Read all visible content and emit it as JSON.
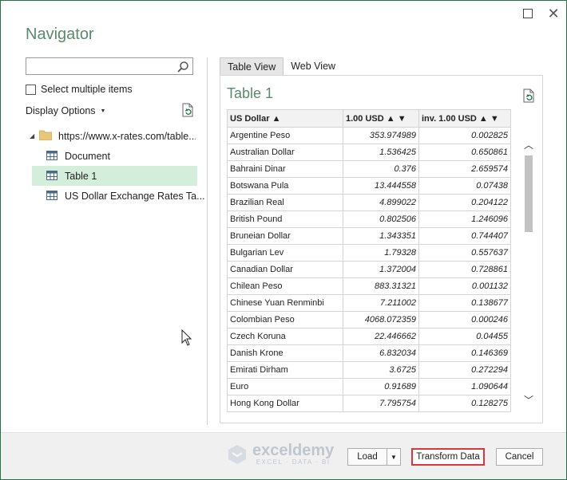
{
  "window": {
    "title": "Navigator",
    "maximize_icon": "maximize-icon",
    "close_glyph": "✕"
  },
  "left": {
    "search": {
      "placeholder": "",
      "value": ""
    },
    "select_multiple_label": "Select multiple items",
    "display_options_label": "Display Options",
    "tree": {
      "root_label": "https://www.x-rates.com/table...",
      "items": [
        {
          "label": "Document",
          "selected": false
        },
        {
          "label": "Table 1",
          "selected": true
        },
        {
          "label": "US Dollar Exchange Rates Ta...",
          "selected": false
        }
      ]
    }
  },
  "right": {
    "tabs": [
      {
        "label": "Table View",
        "active": true
      },
      {
        "label": "Web View",
        "active": false
      }
    ],
    "table_title": "Table 1",
    "columns": [
      "US Dollar ▲",
      "1.00 USD ▲ ▼",
      "inv. 1.00 USD ▲ ▼"
    ],
    "rows": [
      [
        "Argentine Peso",
        "353.974989",
        "0.002825"
      ],
      [
        "Australian Dollar",
        "1.536425",
        "0.650861"
      ],
      [
        "Bahraini Dinar",
        "0.376",
        "2.659574"
      ],
      [
        "Botswana Pula",
        "13.444558",
        "0.07438"
      ],
      [
        "Brazilian Real",
        "4.899022",
        "0.204122"
      ],
      [
        "British Pound",
        "0.802506",
        "1.246096"
      ],
      [
        "Bruneian Dollar",
        "1.343351",
        "0.744407"
      ],
      [
        "Bulgarian Lev",
        "1.79328",
        "0.557637"
      ],
      [
        "Canadian Dollar",
        "1.372004",
        "0.728861"
      ],
      [
        "Chilean Peso",
        "883.31321",
        "0.001132"
      ],
      [
        "Chinese Yuan Renminbi",
        "7.211002",
        "0.138677"
      ],
      [
        "Colombian Peso",
        "4068.072359",
        "0.000246"
      ],
      [
        "Czech Koruna",
        "22.446662",
        "0.04455"
      ],
      [
        "Danish Krone",
        "6.832034",
        "0.146369"
      ],
      [
        "Emirati Dirham",
        "3.6725",
        "0.272294"
      ],
      [
        "Euro",
        "0.91689",
        "1.090644"
      ],
      [
        "Hong Kong Dollar",
        "7.795754",
        "0.128275"
      ]
    ]
  },
  "footer": {
    "watermark": {
      "name": "exceldemy",
      "tagline": "EXCEL · DATA · BI"
    },
    "load_label": "Load",
    "transform_label": "Transform Data",
    "cancel_label": "Cancel"
  },
  "colors": {
    "accent": "#217346",
    "title": "#5a8a6a",
    "selected_row": "#d5eedc",
    "highlight_border": "#d9363e"
  }
}
